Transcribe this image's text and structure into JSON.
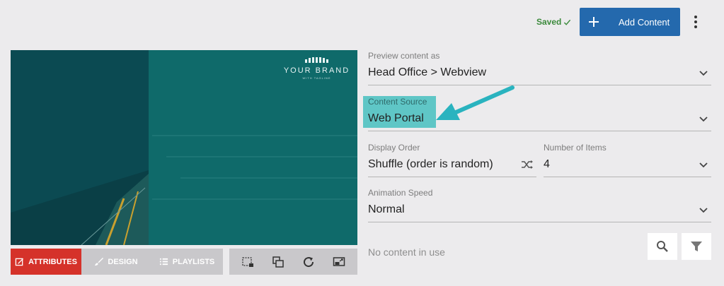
{
  "header": {
    "saved_label": "Saved",
    "add_content_label": "Add Content"
  },
  "preview": {
    "brand_name": "YOUR BRAND",
    "brand_tagline": "WITH TAGLINE"
  },
  "toolbar": {
    "tabs": [
      {
        "label": "ATTRIBUTES",
        "icon": "edit-icon",
        "active": true
      },
      {
        "label": "DESIGN",
        "icon": "brush-icon",
        "active": false
      },
      {
        "label": "PLAYLISTS",
        "icon": "list-icon",
        "active": false
      }
    ],
    "tools": [
      "crop-icon",
      "layers-icon",
      "refresh-icon",
      "screen-cast-icon"
    ]
  },
  "form": {
    "preview_as": {
      "label": "Preview content as",
      "value": "Head Office > Webview"
    },
    "content_source": {
      "label": "Content Source",
      "value": "Web Portal"
    },
    "display_order": {
      "label": "Display Order",
      "value": "Shuffle (order is random)"
    },
    "number_of_items": {
      "label": "Number of Items",
      "value": "4"
    },
    "animation_speed": {
      "label": "Animation Speed",
      "value": "Normal"
    }
  },
  "content_status": "No content in use",
  "colors": {
    "accent_blue": "#2469ad",
    "active_red": "#d5322a",
    "highlight_teal": "#5fc6c6",
    "saved_green": "#3c8a3c"
  }
}
